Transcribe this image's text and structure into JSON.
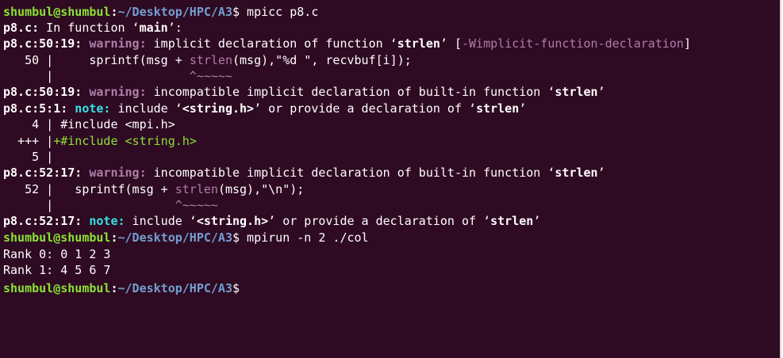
{
  "terminal": {
    "prompt_user": "shumbul@shumbul",
    "prompt_sep": ":",
    "prompt_path": "~/Desktop/HPC/A3",
    "prompt_symbol": "$",
    "cmd1": " mpicc p8.c",
    "cmd2": " mpirun -n 2 ./col",
    "l1_file": "p8.c:",
    "l1_text": " In function ‘",
    "l1_func": "main",
    "l1_end": "’:",
    "w1_loc": "p8.c:50:19:",
    "w1_kind": " warning:",
    "w1_text": " implicit declaration of function ‘",
    "w1_func": "strlen",
    "w1_mid": "’ [",
    "w1_flag": "-Wimplicit-function-declaration",
    "w1_end": "]",
    "src50_gutter": "   50 |",
    "src50_a": "     sprintf(msg + ",
    "src50_hl": "strlen",
    "src50_b": "(msg),\"%d \", recvbuf[i]);",
    "car1_gutter": "      |",
    "car1": "                   ^~~~~~",
    "w2_loc": "p8.c:50:19:",
    "w2_kind": " warning:",
    "w2_text": " incompatible implicit declaration of built-in function ‘",
    "w2_func": "strlen",
    "w2_end": "’",
    "n1_loc": "p8.c:5:1:",
    "n1_kind": " note:",
    "n1_a": " include ‘",
    "n1_hdr": "<string.h>",
    "n1_b": "’ or provide a declaration of ‘",
    "n1_func": "strlen",
    "n1_end": "’",
    "src4_gutter": "    4 |",
    "src4_code": " #include <mpi.h>",
    "add_gutter": "  +++ |",
    "add_code": "+#include <string.h>",
    "src5_gutter": "    5 |",
    "w3_loc": "p8.c:52:17:",
    "w3_kind": " warning:",
    "w3_text": " incompatible implicit declaration of built-in function ‘",
    "w3_func": "strlen",
    "w3_end": "’",
    "src52_gutter": "   52 |",
    "src52_a": "   sprintf(msg + ",
    "src52_hl": "strlen",
    "src52_b": "(msg),\"\\n\");",
    "car2_gutter": "      |",
    "car2": "                 ^~~~~~",
    "n2_loc": "p8.c:52:17:",
    "n2_kind": " note:",
    "n2_a": " include ‘",
    "n2_hdr": "<string.h>",
    "n2_b": "’ or provide a declaration of ‘",
    "n2_func": "strlen",
    "n2_end": "’",
    "out1": "Rank 0: 0 1 2 3",
    "out2": "Rank 1: 4 5 6 7"
  },
  "colors": {
    "background": "#2f0a23",
    "user": "#8ae234",
    "path": "#729fcf",
    "warning": "#ad7fa8",
    "note": "#34e2e2"
  }
}
